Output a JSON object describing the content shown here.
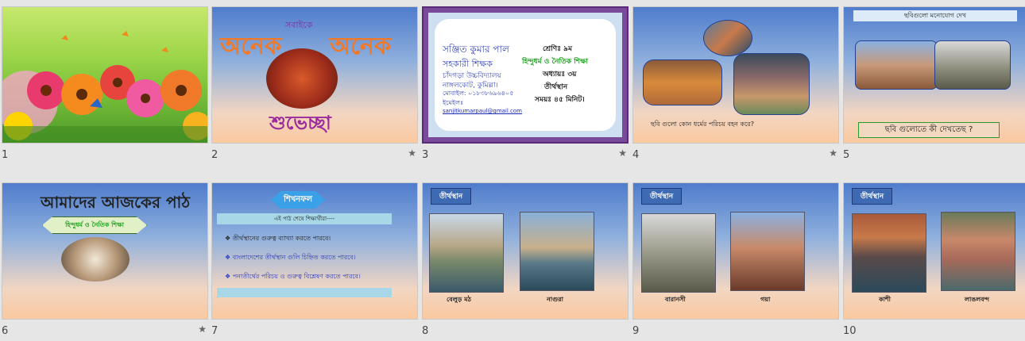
{
  "slides": [
    {
      "number": "1",
      "starred": false
    },
    {
      "number": "2",
      "starred": true,
      "top_text": "সবাইকে",
      "left_word": "অনেক",
      "right_word": "অনেক",
      "bottom_text": "শুভেচ্ছা"
    },
    {
      "number": "3",
      "starred": true,
      "name": "সঞ্জিত কুমার পাল",
      "designation": "সহকারী শিক্ষক",
      "school": "চাঁদগড়া উচ্চবিদ্যালয়",
      "location": "নাঙ্গলকোট, কুমিল্লা।",
      "mobile": "মোবাইল: ০১৮৩৮৬৯৬৪০৫",
      "email_label": "ইমেইলঃ",
      "email": "sanjitkumarpaul@gmail.com",
      "class": "শ্রেণিঃ ৯ম",
      "subject": "হিন্দুধর্ম ও নৈতিক শিক্ষা",
      "chapter": "অধ্যায়ঃ ৩য়",
      "topic": "তীর্থস্থান",
      "time": "সময়ঃ ৪৫ মিনিট।"
    },
    {
      "number": "4",
      "starred": true,
      "question": "ছবি গুলো কোন ধর্মের পরিচয় বহন করে?"
    },
    {
      "number": "5",
      "starred": true,
      "header": "ছবিগুলো মনোযোগ দেখ",
      "question": "ছবি গুলোতে কী দেখতেছ ?"
    },
    {
      "number": "6",
      "starred": true,
      "title": "আমাদের আজকের পাঠ",
      "subtitle": "হিন্দুধর্ম ও নৈতিক শিক্ষা"
    },
    {
      "number": "7",
      "starred": false,
      "badge": "শিখনফল",
      "subheader": "এই পাঠ শেষে শিক্ষার্থীরা----",
      "items": [
        "তীর্থস্থানের গুরুত্ব ব্যাখ্যা করতে পারবে।",
        "বাংলাদেশের তীর্থস্থান গুলি চিহ্নিত করতে পারবে।",
        "পনাতীর্থের পরিচয় ও গুরুত্ব বিশ্লেষণ করতে পারবে।"
      ]
    },
    {
      "number": "8",
      "starred": false,
      "tag": "তীর্থস্থান",
      "captions": [
        "বেলুড় মঠ",
        "নাগুরা"
      ]
    },
    {
      "number": "9",
      "starred": false,
      "tag": "তীর্থস্থান",
      "captions": [
        "বারানসী",
        "গয়া"
      ]
    },
    {
      "number": "10",
      "starred": false,
      "tag": "তীর্থস্থান",
      "captions": [
        "কাশী",
        "লাঙলবন্দ"
      ]
    }
  ],
  "colors": {
    "accent_orange": "#f07a2a",
    "title_purple": "#9b2a9c",
    "teal": "#1fa0a0"
  }
}
